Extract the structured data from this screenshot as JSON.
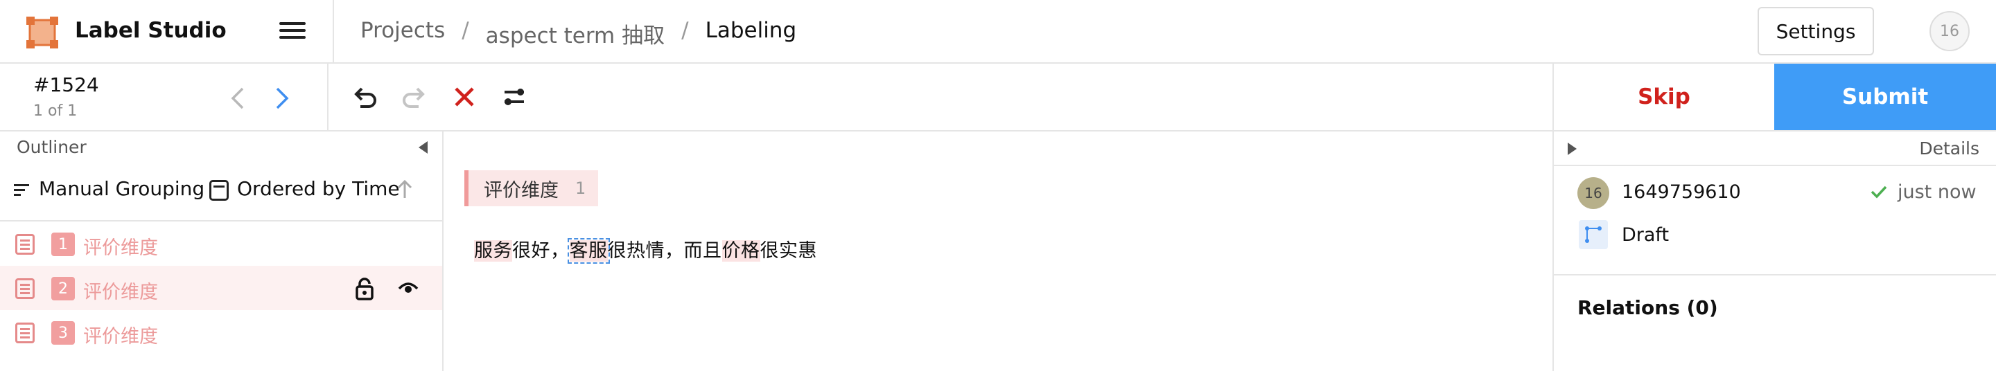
{
  "header": {
    "app_title": "Label Studio",
    "breadcrumb": [
      "Projects",
      "aspect term 抽取",
      "Labeling"
    ],
    "breadcrumb_sep": "/",
    "settings_label": "Settings",
    "user_initials": "16"
  },
  "task": {
    "id": "#1524",
    "count": "1 of 1"
  },
  "actions": {
    "skip_label": "Skip",
    "submit_label": "Submit"
  },
  "outliner": {
    "title": "Outliner",
    "grouping_label": "Manual Grouping",
    "ordering_label": "Ordered by Time",
    "regions": [
      {
        "num": "1",
        "label": "评价维度",
        "selected": false
      },
      {
        "num": "2",
        "label": "评价维度",
        "selected": true
      },
      {
        "num": "3",
        "label": "评价维度",
        "selected": false
      }
    ]
  },
  "labels": {
    "name": "评价维度",
    "hotkey": "1"
  },
  "text": {
    "seg1": "服务",
    "seg2": "很好，",
    "seg3": "客服",
    "seg4": "很热情，而且",
    "seg5": "价格",
    "seg6": "很实惠"
  },
  "details": {
    "title": "Details",
    "annotator_initials": "16",
    "annotator": "1649759610",
    "time": "just now",
    "status": "Draft",
    "relations": "Relations (0)"
  },
  "colors": {
    "accent": "#3f9cf7",
    "skip": "#d0211c",
    "label": "#f09a9a",
    "region_text": "#ec9a9a",
    "success": "#4caf50"
  },
  "icons": {
    "logo": "label-studio-logo",
    "menu": "hamburger-icon",
    "prev": "chevron-left-icon",
    "next": "chevron-right-icon",
    "undo": "undo-icon",
    "redo": "redo-icon",
    "reset": "close-icon",
    "settings": "toggle-icon",
    "lock": "lock-icon",
    "eye": "eye-icon"
  }
}
